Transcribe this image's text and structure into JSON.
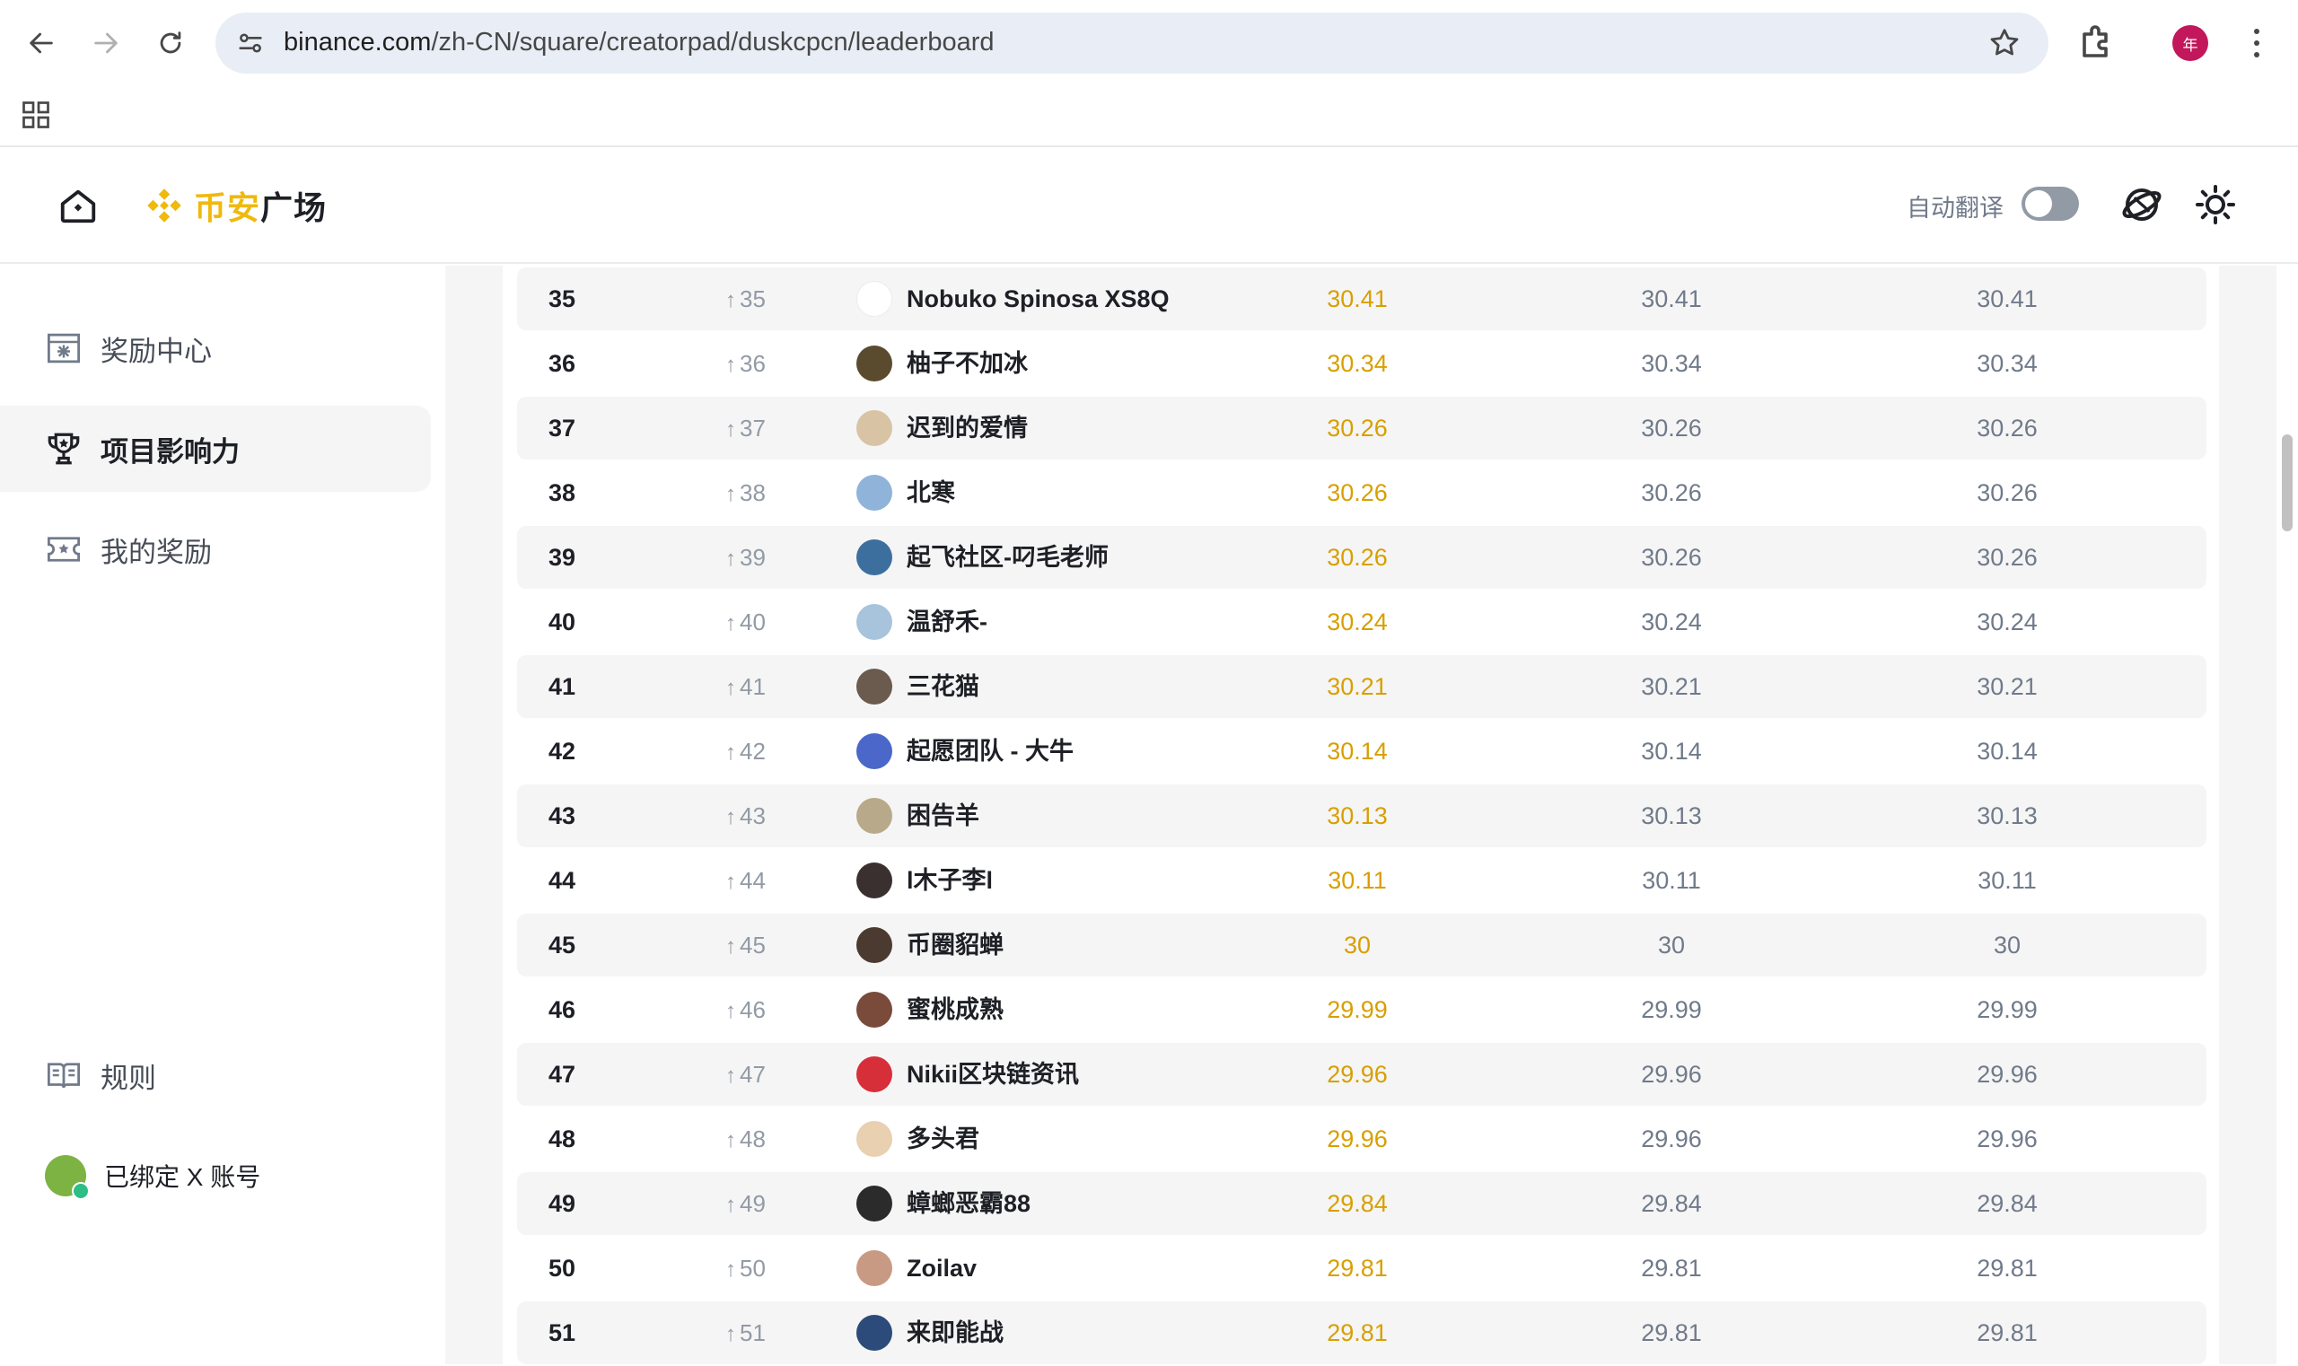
{
  "browser": {
    "url_host": "binance.com",
    "url_path": "/zh-CN/square/creatorpad/duskcpcn/leaderboard",
    "profile_initial": "年"
  },
  "header": {
    "logo_text_accent": "币安",
    "logo_text_main": "广场",
    "auto_translate_label": "自动翻译",
    "auto_translate_on": false
  },
  "sidebar": {
    "items": [
      {
        "label": "奖励中心",
        "icon": "reward-center-icon",
        "active": false
      },
      {
        "label": "项目影响力",
        "icon": "trophy-icon",
        "active": true
      },
      {
        "label": "我的奖励",
        "icon": "ticket-icon",
        "active": false
      }
    ],
    "bottom_items": [
      {
        "label": "规则",
        "icon": "book-icon"
      },
      {
        "label": "已绑定 X 账号",
        "icon": "avatar"
      }
    ]
  },
  "leaderboard": {
    "rows": [
      {
        "rank": "35",
        "change": "35",
        "name": "Nobuko Spinosa XS8Q",
        "score": "30.41",
        "v2": "30.41",
        "v3": "30.41",
        "avatar_color": "#ffffff"
      },
      {
        "rank": "36",
        "change": "36",
        "name": "柚子不加冰",
        "score": "30.34",
        "v2": "30.34",
        "v3": "30.34",
        "avatar_color": "#5a4a2e"
      },
      {
        "rank": "37",
        "change": "37",
        "name": "迟到的爱情",
        "score": "30.26",
        "v2": "30.26",
        "v3": "30.26",
        "avatar_color": "#d8c3a5"
      },
      {
        "rank": "38",
        "change": "38",
        "name": "北寒",
        "score": "30.26",
        "v2": "30.26",
        "v3": "30.26",
        "avatar_color": "#8fb3d9"
      },
      {
        "rank": "39",
        "change": "39",
        "name": "起飞社区-叼毛老师",
        "score": "30.26",
        "v2": "30.26",
        "v3": "30.26",
        "avatar_color": "#3d6f9e"
      },
      {
        "rank": "40",
        "change": "40",
        "name": "温舒禾-",
        "score": "30.24",
        "v2": "30.24",
        "v3": "30.24",
        "avatar_color": "#a8c4dc"
      },
      {
        "rank": "41",
        "change": "41",
        "name": "三花猫",
        "score": "30.21",
        "v2": "30.21",
        "v3": "30.21",
        "avatar_color": "#6b5b4e"
      },
      {
        "rank": "42",
        "change": "42",
        "name": "起愿团队 - 大牛",
        "score": "30.14",
        "v2": "30.14",
        "v3": "30.14",
        "avatar_color": "#4a67c9"
      },
      {
        "rank": "43",
        "change": "43",
        "name": "困告羊",
        "score": "30.13",
        "v2": "30.13",
        "v3": "30.13",
        "avatar_color": "#b8a98a"
      },
      {
        "rank": "44",
        "change": "44",
        "name": "l木子李l",
        "score": "30.11",
        "v2": "30.11",
        "v3": "30.11",
        "avatar_color": "#3a3030"
      },
      {
        "rank": "45",
        "change": "45",
        "name": "币圈貂蝉",
        "score": "30",
        "v2": "30",
        "v3": "30",
        "avatar_color": "#4b3a2f"
      },
      {
        "rank": "46",
        "change": "46",
        "name": "蜜桃成熟",
        "score": "29.99",
        "v2": "29.99",
        "v3": "29.99",
        "avatar_color": "#7a4a3a"
      },
      {
        "rank": "47",
        "change": "47",
        "name": "Nikii区块链资讯",
        "score": "29.96",
        "v2": "29.96",
        "v3": "29.96",
        "avatar_color": "#d62f3a"
      },
      {
        "rank": "48",
        "change": "48",
        "name": "多头君",
        "score": "29.96",
        "v2": "29.96",
        "v3": "29.96",
        "avatar_color": "#e8d0b0"
      },
      {
        "rank": "49",
        "change": "49",
        "name": "蟑螂恶霸88",
        "score": "29.84",
        "v2": "29.84",
        "v3": "29.84",
        "avatar_color": "#2b2b2b"
      },
      {
        "rank": "50",
        "change": "50",
        "name": "Zoilav",
        "score": "29.81",
        "v2": "29.81",
        "v3": "29.81",
        "avatar_color": "#c89a84"
      },
      {
        "rank": "51",
        "change": "51",
        "name": "来即能战",
        "score": "29.81",
        "v2": "29.81",
        "v3": "29.81",
        "avatar_color": "#2c4a7a"
      }
    ]
  },
  "colors": {
    "brand": "#f0b90b",
    "score": "#d89f00",
    "muted": "#707a8a"
  }
}
